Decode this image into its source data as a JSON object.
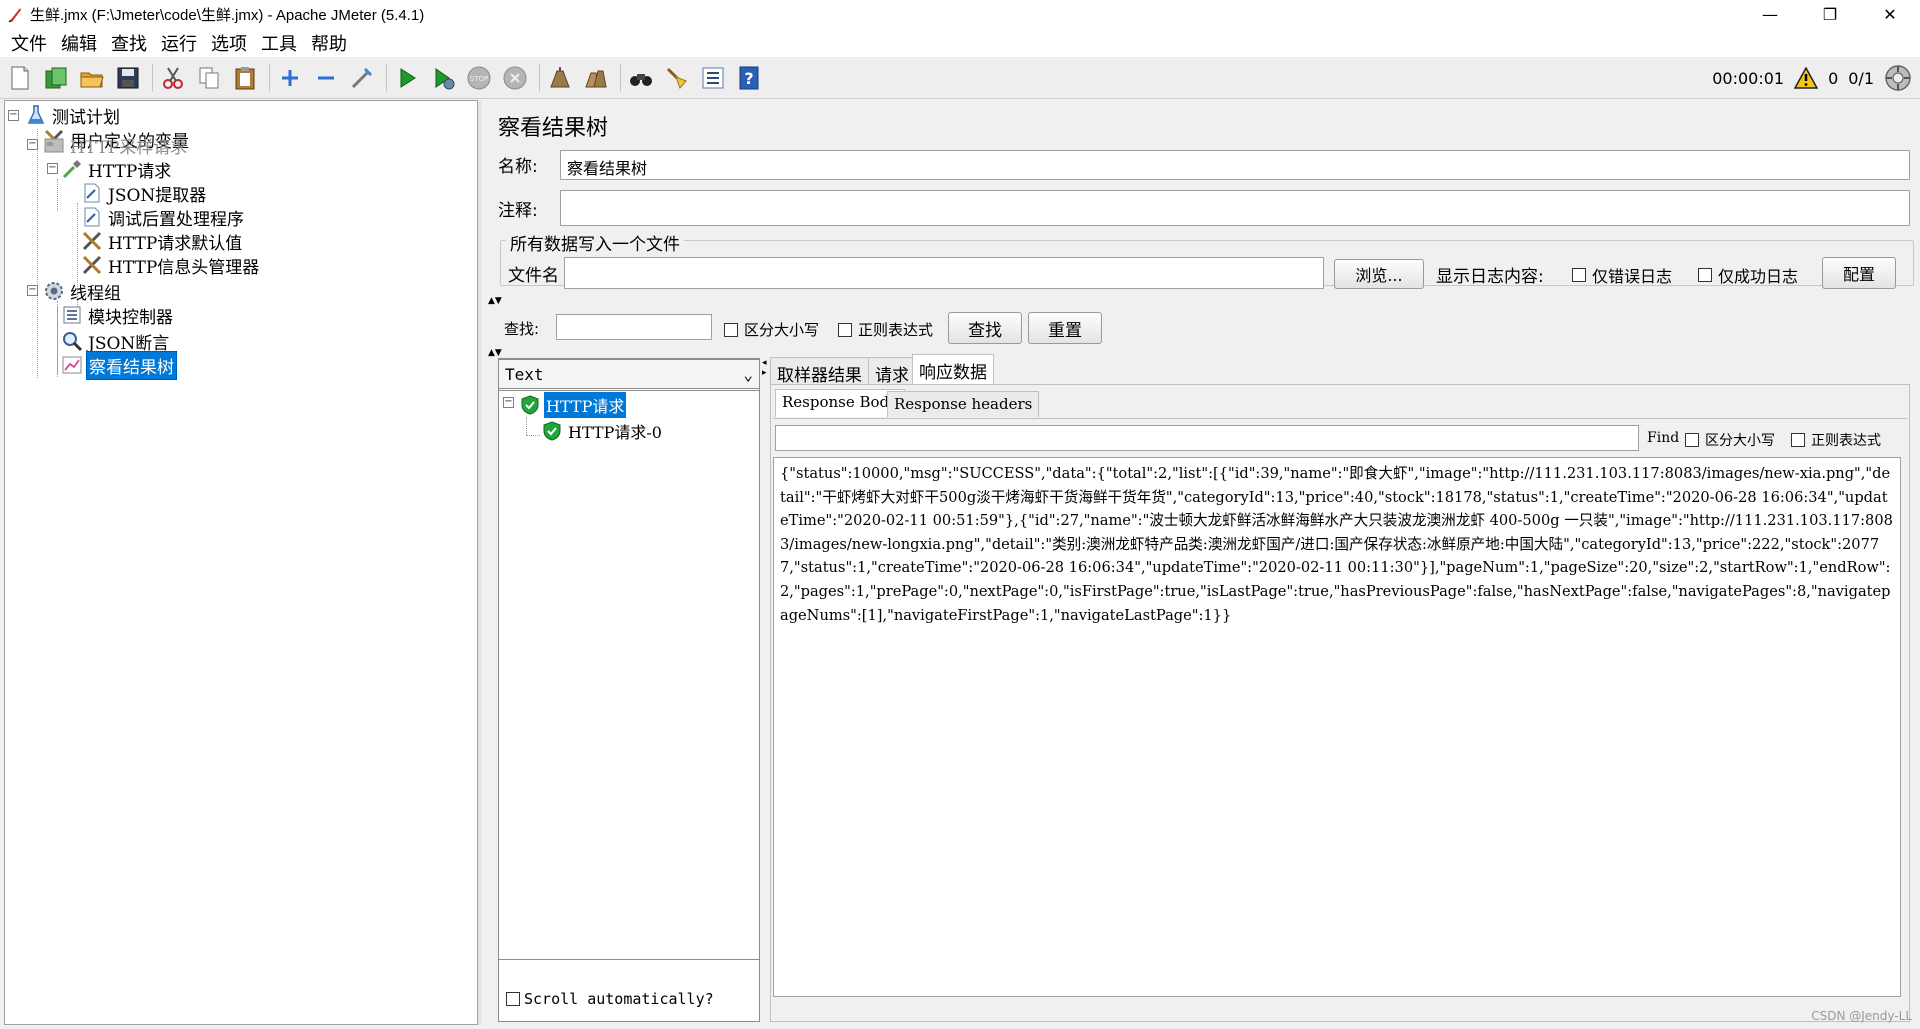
{
  "window": {
    "title": "生鲜.jmx (F:\\Jmeter\\code\\生鲜.jmx) - Apache JMeter (5.4.1)",
    "minimize": "—",
    "maximize": "❐",
    "close": "✕"
  },
  "menu": [
    "文件",
    "编辑",
    "查找",
    "运行",
    "选项",
    "工具",
    "帮助"
  ],
  "status": {
    "elapsed": "00:00:01",
    "warnings": "0",
    "threads": "0/1"
  },
  "tree": {
    "test_plan": "测试计划",
    "user_vars": "用户定义的变量",
    "http_sampler_group": "HTTP采样请求",
    "http_request": "HTTP请求",
    "json_extractor": "JSON提取器",
    "debug_post": "调试后置处理程序",
    "http_defaults": "HTTP请求默认值",
    "header_manager": "HTTP信息头管理器",
    "thread_group": "线程组",
    "module_controller": "模块控制器",
    "json_assertion": "JSON断言",
    "results_tree": "察看结果树"
  },
  "panel": {
    "title": "察看结果树",
    "name_label": "名称:",
    "name_value": "察看结果树",
    "comment_label": "注释:",
    "comment_value": "",
    "file_group_title": "所有数据写入一个文件",
    "filename_label": "文件名",
    "filename_value": "",
    "browse_button": "浏览...",
    "log_label": "显示日志内容:",
    "errors_only": "仅错误日志",
    "success_only": "仅成功日志",
    "config_button": "配置"
  },
  "search": {
    "label": "查找:",
    "value": "",
    "case_sensitive": "区分大小写",
    "regex": "正则表达式",
    "search_button": "查找",
    "reset_button": "重置"
  },
  "results": {
    "renderer": "Text",
    "parent_sample": "HTTP请求",
    "child_sample": "HTTP请求-0",
    "scroll_auto": "Scroll automatically?"
  },
  "tabs": {
    "sampler_result": "取样器结果",
    "request": "请求",
    "response_data": "响应数据"
  },
  "subtabs": {
    "body": "Response Body",
    "headers": "Response headers"
  },
  "find": {
    "label": "Find",
    "value": "",
    "case_sensitive": "区分大小写",
    "regex": "正则表达式"
  },
  "response_body": "{\"status\":10000,\"msg\":\"SUCCESS\",\"data\":{\"total\":2,\"list\":[{\"id\":39,\"name\":\"即食大虾\",\"image\":\"http://111.231.103.117:8083/images/new-xia.png\",\"detail\":\"干虾烤虾大对虾干500g淡干烤海虾干货海鲜干货年货\",\"categoryId\":13,\"price\":40,\"stock\":18178,\"status\":1,\"createTime\":\"2020-06-28 16:06:34\",\"updateTime\":\"2020-02-11 00:51:59\"},{\"id\":27,\"name\":\"波士顿大龙虾鲜活冰鲜海鲜水产大只装波龙澳洲龙虾 400-500g 一只装\",\"image\":\"http://111.231.103.117:8083/images/new-longxia.png\",\"detail\":\"类别:澳洲龙虾特产品类:澳洲龙虾国产/进口:国产保存状态:冰鲜原产地:中国大陆\",\"categoryId\":13,\"price\":222,\"stock\":20777,\"status\":1,\"createTime\":\"2020-06-28 16:06:34\",\"updateTime\":\"2020-02-11 00:11:30\"}],\"pageNum\":1,\"pageSize\":20,\"size\":2,\"startRow\":1,\"endRow\":2,\"pages\":1,\"prePage\":0,\"nextPage\":0,\"isFirstPage\":true,\"isLastPage\":true,\"hasPreviousPage\":false,\"hasNextPage\":false,\"navigatePages\":8,\"navigatepageNums\":[1],\"navigateFirstPage\":1,\"navigateLastPage\":1}}",
  "watermark": "CSDN @Jendy-LL"
}
